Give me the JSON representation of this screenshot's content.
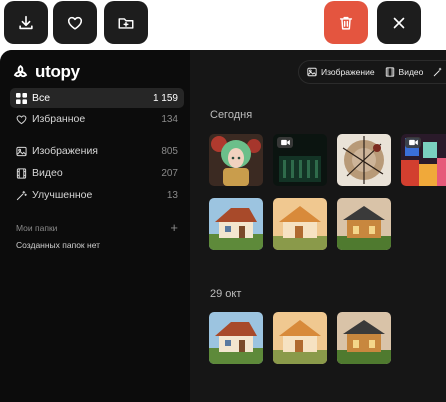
{
  "toolbar": {
    "download_icon": "download-icon",
    "favorite_icon": "heart-icon",
    "move_icon": "folder-plus-icon",
    "delete_icon": "trash-icon",
    "close_icon": "close-icon"
  },
  "app": {
    "logo_text": "utopy"
  },
  "sidebar": {
    "items": [
      {
        "label": "Все",
        "count": "1 159",
        "icon": "grid-icon"
      },
      {
        "label": "Избранное",
        "count": "134",
        "icon": "heart-icon"
      },
      {
        "label": "Изображения",
        "count": "805",
        "icon": "image-icon"
      },
      {
        "label": "Видео",
        "count": "207",
        "icon": "film-icon"
      },
      {
        "label": "Улучшенное",
        "count": "13",
        "icon": "magic-wand-icon"
      }
    ],
    "folders_title": "Мои папки",
    "folders_empty": "Созданных папок нет"
  },
  "filters": {
    "image_label": "Изображение",
    "video_label": "Видео"
  },
  "gallery": {
    "sections": [
      {
        "title": "Сегодня"
      },
      {
        "title": "29 окт"
      }
    ]
  },
  "colors": {
    "accent_danger": "#e4553f",
    "window_bg": "#161616",
    "sidebar_bg": "#0c0c0c"
  }
}
